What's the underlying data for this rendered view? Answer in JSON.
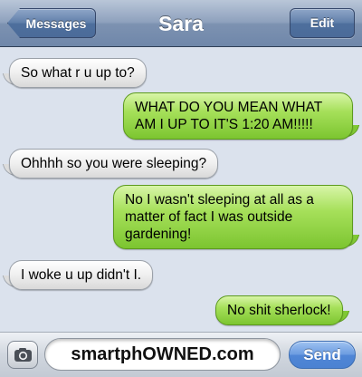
{
  "header": {
    "back_label": "Messages",
    "title": "Sara",
    "edit_label": "Edit"
  },
  "messages": [
    {
      "direction": "incoming",
      "text": "So what r u up to?"
    },
    {
      "direction": "outgoing",
      "text": "WHAT DO YOU MEAN WHAT AM I UP TO IT'S 1:20 AM!!!!!"
    },
    {
      "direction": "incoming",
      "text": "Ohhhh so you were sleeping?"
    },
    {
      "direction": "outgoing",
      "text": "No I wasn't sleeping at all as a matter of fact I was outside gardening!"
    },
    {
      "direction": "incoming",
      "text": "I woke u up didn't I."
    },
    {
      "direction": "outgoing",
      "text": "No shit sherlock!"
    }
  ],
  "composer": {
    "input_value": "smartphOWNED.com",
    "send_label": "Send",
    "camera_icon": "camera-icon"
  },
  "colors": {
    "outgoing_bubble": "#8fd144",
    "incoming_bubble": "#e6e6e6",
    "background": "#dbe2ed",
    "navbar": "#7d92b1",
    "send_button": "#5086d6"
  }
}
